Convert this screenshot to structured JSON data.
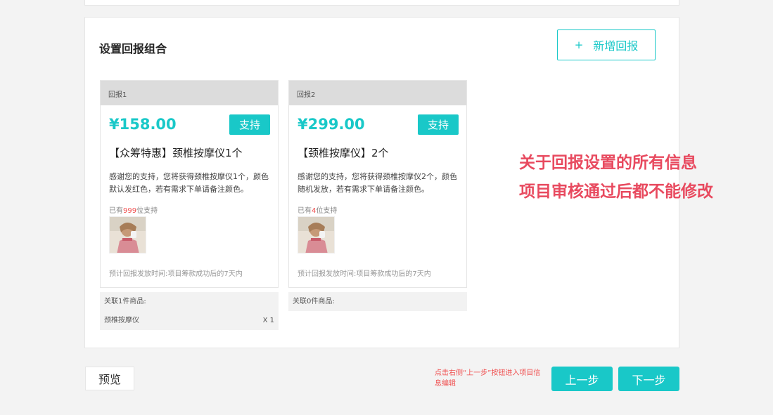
{
  "section": {
    "title": "设置回报组合",
    "add_button": "新增回报",
    "add_icon": "plus-icon"
  },
  "rewards": [
    {
      "header": "回报1",
      "price": "¥158.00",
      "support_label": "支持",
      "title": "【众筹特惠】颈椎按摩仪1个",
      "description": "感谢您的支持，您将获得颈椎按摩仪1个，颜色默认发红色，若有需求下单请备注颜色。",
      "backers_prefix": "已有",
      "backers_count": "999",
      "backers_suffix": "位支持",
      "eta": "预计回报发放时间:项目筹款成功后的7天内",
      "linked_title": "关联1件商品:",
      "linked_items": [
        {
          "name": "颈椎按摩仪",
          "qty": "X 1"
        }
      ]
    },
    {
      "header": "回报2",
      "price": "¥299.00",
      "support_label": "支持",
      "title": "【颈椎按摩仪】2个",
      "description": "感谢您的支持，您将获得颈椎按摩仪2个，颜色随机发放，若有需求下单请备注颜色。",
      "backers_prefix": "已有",
      "backers_count": "4",
      "backers_suffix": "位支持",
      "eta": "预计回报发放时间:项目筹款成功后的7天内",
      "linked_title": "关联0件商品:",
      "linked_items": []
    }
  ],
  "note": {
    "line1": "关于回报设置的所有信息",
    "line2": "项目审核通过后都不能修改"
  },
  "footer": {
    "preview": "预览",
    "hint": "点击右侧“上一步”按钮进入项目信息编辑",
    "prev": "上一步",
    "next": "下一步"
  },
  "colors": {
    "accent": "#19c8c8",
    "warning": "#e84a5f",
    "count": "#f05050"
  }
}
